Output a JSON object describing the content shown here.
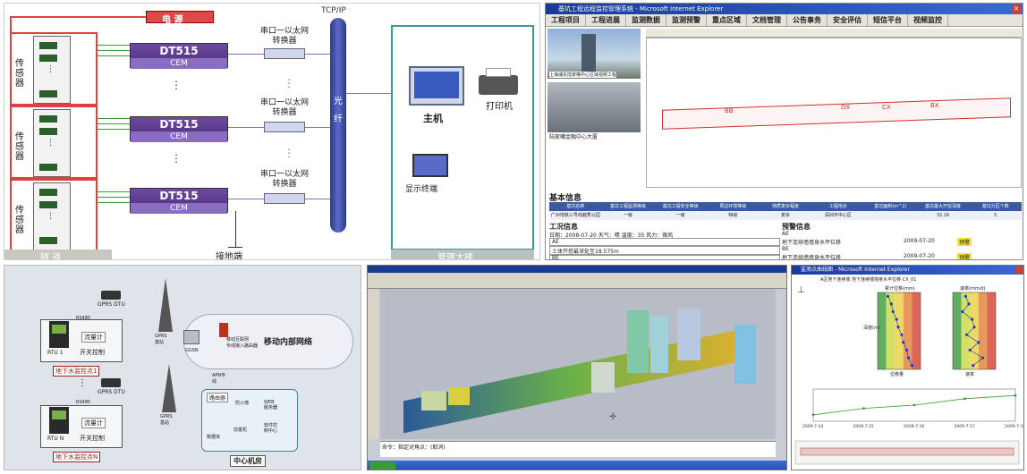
{
  "system_diagram": {
    "power_label": "电 源",
    "protocol_label": "TCP/IP",
    "sensor_label": "传感器",
    "dt_labels": [
      "DT515",
      "DT515",
      "DT515"
    ],
    "dt_sub": [
      "CEM",
      "CEM",
      "CEM"
    ],
    "converter_labels": [
      "串口一以太网\n转换器",
      "串口一以太网\n转换器",
      "串口一以太网\n转换器"
    ],
    "backbone_label": "光纤",
    "host_label": "主机",
    "printer_label": "打印机",
    "terminal_label": "显示终端",
    "ground_label": "接地端",
    "tunnel_label": "隧 道",
    "building_label": "管理大楼"
  },
  "monitor_app": {
    "window_title": "基坑工程远程监控管理系统 - Microsoft Internet Explorer",
    "menu": [
      "工程项目",
      "工程进展",
      "监测数据",
      "监测预警",
      "重点区域",
      "文档管理",
      "公告事务",
      "安全评估",
      "短信平台",
      "视频监控"
    ],
    "photo_captions": [
      "上海浦东陆家嘴中心区域视频工程",
      "陆家嘴金融中心大厦"
    ],
    "plan_labels": [
      "BB",
      "DX",
      "CX",
      "BX"
    ],
    "basic_info_title": "基本信息",
    "table_headers": [
      "基坑名称",
      "基坑工程监测等级",
      "基坑工程安全等级",
      "周边环境等级",
      "地质复杂程度",
      "工程地点",
      "基坑面积(m^2)",
      "基坑最大开挖深度",
      "基坑分区个数"
    ],
    "table_row": [
      "广州地铁三号线越秀公园站工程",
      "一级",
      "一级",
      "特级",
      "复杂",
      "深圳市中心区",
      "",
      "32.16",
      "5"
    ],
    "work_info_title": "工况信息",
    "work_info_line": "日期：2008-07-20  天气：晴  温度：35  风力：微风",
    "work_rows": [
      "AE",
      "土体开挖最深处至18.575m",
      "BE"
    ],
    "alert_title": "预警信息",
    "alert_rows": [
      {
        "code": "AE",
        "desc": "地下连续墙墙身水平位移",
        "date": "2009-07-20",
        "status": "预警"
      },
      {
        "code": "BE",
        "desc": "地下连续墙墙身水平位移",
        "date": "2009-07-20",
        "status": "预警"
      }
    ]
  },
  "groundwater": {
    "gprs_labels": [
      "GPRS DTU",
      "GPRS DTU"
    ],
    "rs485": [
      "RS485",
      "RS485"
    ],
    "rtu_labels": [
      "RTU 1",
      "RTU N"
    ],
    "flow_labels": [
      "流量计",
      "流量计"
    ],
    "switch_labels": [
      "开关控制",
      "开关控制"
    ],
    "station_labels": [
      "地下水监控点1",
      "地下水监控点N"
    ],
    "base_labels": [
      "GPRS\n基站",
      "GPRS\n基站"
    ],
    "ggsn_label": "GGSN",
    "router_label": "移动互联网\n专线接入路由器",
    "network_label": "移动内部网络",
    "apn_label": "APN专\n线",
    "center": {
      "router": "路由器",
      "fw": "防火墙",
      "web": "WEB\n服务器",
      "db": "数据库",
      "pc": "前置机",
      "ctrl": "软件控\n制中心",
      "title": "中心机房"
    }
  },
  "cad_view": {
    "status_text": "命令：指定对角点：(取消)"
  },
  "chart_window": {
    "title": "监测点曲线图 - Microsoft Internet Explorer",
    "plot_title": "A区地下连续墙 地下连续墙墙身水平位移 CX_01",
    "subplot_titles": [
      "累计位移(mm)",
      "速率(mm/d)"
    ],
    "y_label": "深度(m)",
    "x_labels": [
      "位移量",
      "速率"
    ],
    "time_ticks": [
      "2009-7-14",
      "2009-7-15",
      "2009-7-16",
      "2009-7-17",
      "2009-7-18"
    ]
  },
  "chart_data": [
    {
      "type": "scatter",
      "title": "累计位移(mm)",
      "xlabel": "位移量",
      "ylabel": "深度(m)",
      "xlim": [
        -0.5,
        2.0
      ],
      "ylim": [
        -40,
        0
      ],
      "x": [
        0.1,
        0.3,
        0.4,
        0.6,
        0.7,
        0.9,
        1.0,
        1.2,
        1.3,
        1.5
      ],
      "y": [
        -2,
        -6,
        -10,
        -14,
        -18,
        -22,
        -26,
        -30,
        -34,
        -38
      ]
    },
    {
      "type": "scatter",
      "title": "速率(mm/d)",
      "xlabel": "速率",
      "ylabel": "深度(m)",
      "xlim": [
        -1,
        3
      ],
      "ylim": [
        -40,
        0
      ],
      "x": [
        0.2,
        0.5,
        -0.1,
        0.8,
        1.0,
        0.3,
        1.4,
        0.6,
        1.8,
        0.9
      ],
      "y": [
        -2,
        -6,
        -10,
        -14,
        -18,
        -22,
        -26,
        -30,
        -34,
        -38
      ]
    },
    {
      "type": "line",
      "categories": [
        "2009-7-14",
        "2009-7-15",
        "2009-7-16",
        "2009-7-17",
        "2009-7-18"
      ],
      "values": [
        0.2,
        0.4,
        0.5,
        0.7,
        0.8
      ]
    }
  ]
}
